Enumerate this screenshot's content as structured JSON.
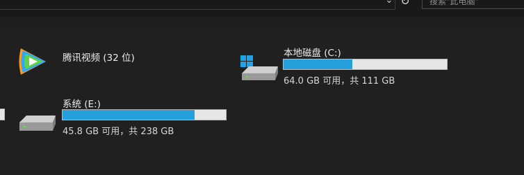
{
  "toolbar": {
    "search_placeholder": "搜索\"此电脑\"",
    "dropdown_icon": "chevron-down-icon",
    "refresh_icon": "refresh-icon"
  },
  "items": [
    {
      "kind": "app",
      "name": "腾讯视频 (32 位)",
      "icon": "tencent-video-icon"
    },
    {
      "kind": "drive",
      "name": "本地磁盘 (C:)",
      "free_text": "64.0 GB 可用，共 111 GB",
      "used_fraction": 0.4234,
      "icon": "windows-drive-icon"
    },
    {
      "kind": "drive",
      "name": "系统 (E:)",
      "free_text": "45.8 GB 可用，共 238 GB",
      "used_fraction": 0.8076,
      "icon": "hard-drive-icon"
    }
  ],
  "colors": {
    "background": "#202020",
    "bar_fill": "#26a0da",
    "bar_track": "#e6e6e6"
  }
}
